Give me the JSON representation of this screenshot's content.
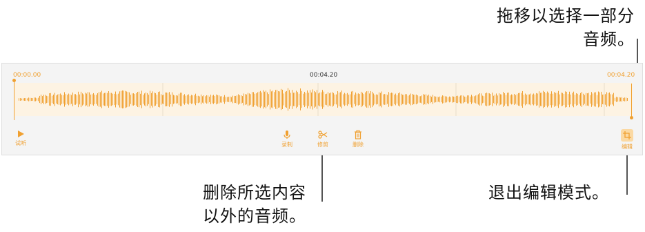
{
  "callouts": {
    "top_line1": "拖移以选择一部分",
    "top_line2": "音频。",
    "bottom_left_line1": "删除所选内容",
    "bottom_left_line2": "以外的音频。",
    "bottom_right": "退出编辑模式。"
  },
  "timeline": {
    "start": "00:00.00",
    "middle": "00:04.20",
    "end": "00:04.20"
  },
  "toolbar": {
    "play": "试听",
    "record": "录制",
    "trim": "修剪",
    "delete": "删除",
    "edit": "编辑"
  },
  "colors": {
    "accent": "#f0a030",
    "panel": "#f4f4f4",
    "selection": "#fdf3e3"
  }
}
